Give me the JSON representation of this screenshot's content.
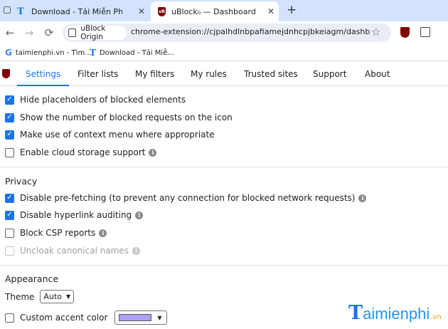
{
  "browser": {
    "tabs": [
      {
        "favicon": "T",
        "title": "Download - Tải Miễn Phí VN - P",
        "active": false
      },
      {
        "favicon": "uB",
        "title": "uBlock₀ — Dashboard",
        "active": true
      }
    ],
    "close_glyph": "✕",
    "new_tab_glyph": "+",
    "toolbar": {
      "back_icon": "←",
      "forward_icon": "→",
      "reload_icon": "⟳",
      "site_chip": "uBlock Origin",
      "url": "chrome-extension://cjpalhdlnbpafiamejdnhcpjbkeiagm/dashboard.html#settings.html",
      "star_icon": "☆"
    },
    "bookmarks": [
      {
        "favicon": "G",
        "label": "taimienphi.vn - Tìm..."
      },
      {
        "favicon": "T",
        "label": "Download - Tải Miễ..."
      }
    ]
  },
  "dashboard": {
    "tabs": [
      "Settings",
      "Filter lists",
      "My filters",
      "My rules",
      "Trusted sites",
      "Support",
      "About"
    ],
    "active_tab": "Settings"
  },
  "settings": {
    "general": [
      {
        "label": "Hide placeholders of blocked elements",
        "checked": true,
        "info": false
      },
      {
        "label": "Show the number of blocked requests on the icon",
        "checked": true,
        "info": false
      },
      {
        "label": "Make use of context menu where appropriate",
        "checked": true,
        "info": false
      },
      {
        "label": "Enable cloud storage support",
        "checked": false,
        "info": true
      }
    ],
    "privacy_title": "Privacy",
    "privacy": [
      {
        "label": "Disable pre-fetching (to prevent any connection for blocked network requests)",
        "checked": true,
        "info": true
      },
      {
        "label": "Disable hyperlink auditing",
        "checked": true,
        "info": true
      },
      {
        "label": "Block CSP reports",
        "checked": false,
        "info": true
      },
      {
        "label": "Uncloak canonical names",
        "checked": false,
        "info": true,
        "disabled": true
      }
    ],
    "appearance_title": "Appearance",
    "theme_label": "Theme",
    "theme_value": "Auto",
    "accent_label": "Custom accent color",
    "accent_checked": false,
    "accent_color": "#aca0f7"
  },
  "checkmark": "✓",
  "info_glyph": "i",
  "caret": "▼",
  "watermark": {
    "t": "T",
    "text": "aimienphi",
    "vn": ".vn"
  }
}
